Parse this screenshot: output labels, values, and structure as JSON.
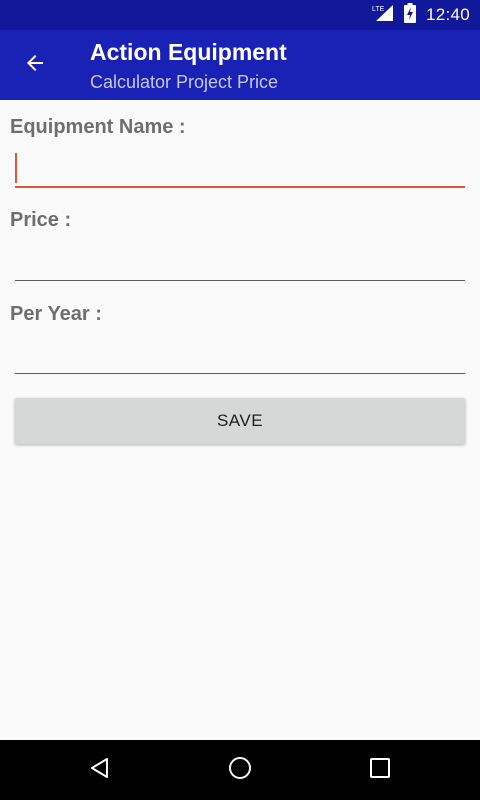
{
  "status_bar": {
    "network": "LTE",
    "time": "12:40"
  },
  "app_bar": {
    "title": "Action Equipment",
    "subtitle": "Calculator Project Price",
    "back_icon": "arrow-left-icon"
  },
  "form": {
    "equipment_name": {
      "label": "Equipment Name :",
      "value": ""
    },
    "price": {
      "label": "Price :",
      "value": ""
    },
    "per_year": {
      "label": "Per Year :",
      "value": ""
    },
    "save_label": "SAVE"
  },
  "nav_bar": {
    "back_icon": "triangle-back-icon",
    "home_icon": "circle-home-icon",
    "recents_icon": "square-recents-icon"
  },
  "colors": {
    "status_bar": "#12189a",
    "app_bar": "#1a22b6",
    "accent": "#e0533b",
    "button": "#d6d7d7"
  }
}
